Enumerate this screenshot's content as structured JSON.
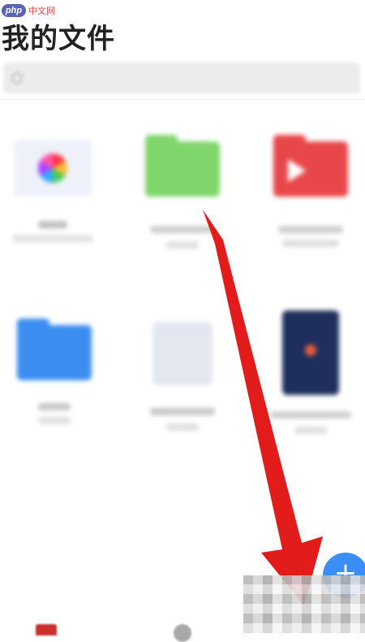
{
  "watermark": {
    "logo": "php",
    "text": "中文网"
  },
  "header": {
    "title": "我的文件"
  },
  "search": {
    "placeholder": ""
  },
  "files": [
    {
      "icon": "photos-icon"
    },
    {
      "icon": "green-folder-icon"
    },
    {
      "icon": "video-folder-icon"
    },
    {
      "icon": "blue-folder-icon"
    },
    {
      "icon": "document-icon"
    },
    {
      "icon": "book-icon"
    }
  ],
  "fab": {
    "label": "+"
  },
  "colors": {
    "accent": "#3a8ef6",
    "arrow": "#e21b1b",
    "title": "#222222"
  }
}
